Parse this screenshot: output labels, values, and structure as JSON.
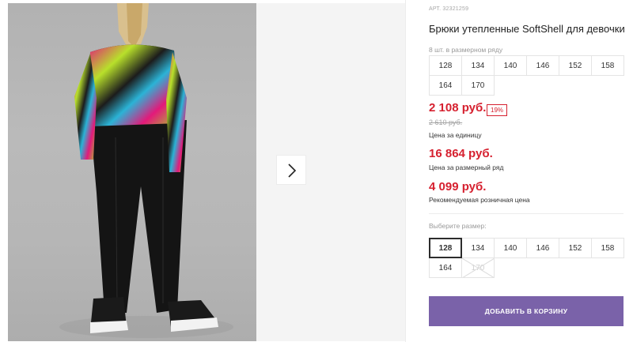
{
  "gallery": {
    "photo_alt": "girl in printed top and black softshell trousers",
    "next_icon": "chevron-right-icon"
  },
  "product": {
    "sku": "АРТ. 32321259",
    "title": "Брюки утепленные SoftShell для девочки"
  },
  "pack": {
    "note": "8 шт. в размерном ряду",
    "sizes": [
      "128",
      "134",
      "140",
      "146",
      "152",
      "158",
      "164",
      "170"
    ]
  },
  "prices": {
    "unit_price": "2 108 руб.",
    "discount": "19%",
    "old_price": "2 610 руб.",
    "unit_caption": "Цена за единицу",
    "pack_price": "16 864 руб.",
    "pack_caption": "Цена за размерный ряд",
    "rrp_price": "4 099 руб.",
    "rrp_caption": "Рекомендуемая розничная цена"
  },
  "size_picker": {
    "label": "Выберите размер:",
    "sizes": [
      "128",
      "134",
      "140",
      "146",
      "152",
      "158",
      "164",
      "170"
    ],
    "selected": "128",
    "unavailable": [
      "170"
    ]
  },
  "cart": {
    "button_label": "ДОБАВИТЬ В КОРЗИНУ"
  },
  "colors": {
    "accent": "#7a62a9",
    "price": "#d6202f"
  }
}
